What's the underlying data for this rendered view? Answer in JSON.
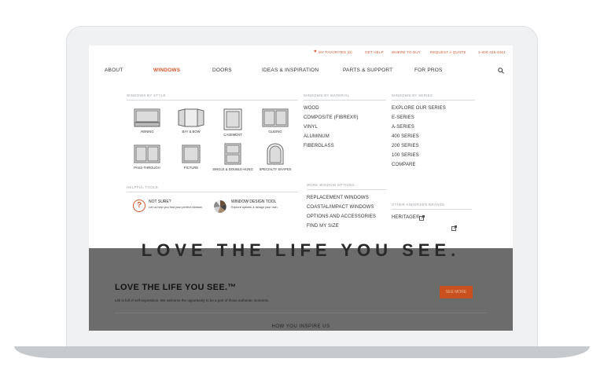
{
  "utility": {
    "favorites": "MY FAVORITES (0)",
    "help": "GET HELP",
    "where": "WHERE TO BUY",
    "quote": "REQUEST A QUOTE",
    "phone": "1-800-426-4261"
  },
  "nav": [
    "ABOUT",
    "WINDOWS",
    "DOORS",
    "IDEAS & INSPIRATION",
    "PARTS & SUPPORT",
    "FOR PROS"
  ],
  "sections": {
    "style": "WINDOWS BY STYLE",
    "material": "WINDOWS BY MATERIAL",
    "series": "WINDOWS BY SERIES",
    "helpful": "HELPFUL TOOLS",
    "more": "MORE WINDOW OPTIONS",
    "brands": "OTHER ANDERSEN BRANDS"
  },
  "styles": [
    "AWNING",
    "BAY & BOW",
    "CASEMENT",
    "GLIDING",
    "PASS-THROUGH",
    "PICTURE",
    "SINGLE & DOUBLE-HUNG",
    "SPECIALTY SHAPES"
  ],
  "materials": [
    "WOOD",
    "COMPOSITE (FIBREX®)",
    "VINYL",
    "ALUMINUM",
    "FIBERGLASS"
  ],
  "series": [
    "EXPLORE OUR SERIES",
    "E-SERIES",
    "A-SERIES",
    "400 SERIES",
    "200 SERIES",
    "100 SERIES",
    "COMPARE"
  ],
  "more_options": [
    "REPLACEMENT WINDOWS",
    "COASTAL/IMPACT WINDOWS",
    "OPTIONS AND ACCESSORIES",
    "FIND MY SIZE"
  ],
  "brands": [
    "HERITAGE®"
  ],
  "tools": {
    "notsure_title": "NOT SURE?",
    "notsure_desc": "Let us help you find your perfect window.",
    "design_title": "WINDOW DESIGN TOOL",
    "design_desc": "Explore options & design your own."
  },
  "hero": {
    "big": "LOVE THE LIFE YOU SEE.",
    "title": "LOVE THE LIFE YOU SEE.™",
    "desc": "Life is full of self-expression. We welcome the opportunity to be a part of those authentic moments.",
    "button": "SEE MORE",
    "sub": "HOW YOU INSPIRE US"
  },
  "colors": {
    "accent": "#d4582c",
    "button": "#c9501f",
    "band": "#6c6c6c"
  }
}
